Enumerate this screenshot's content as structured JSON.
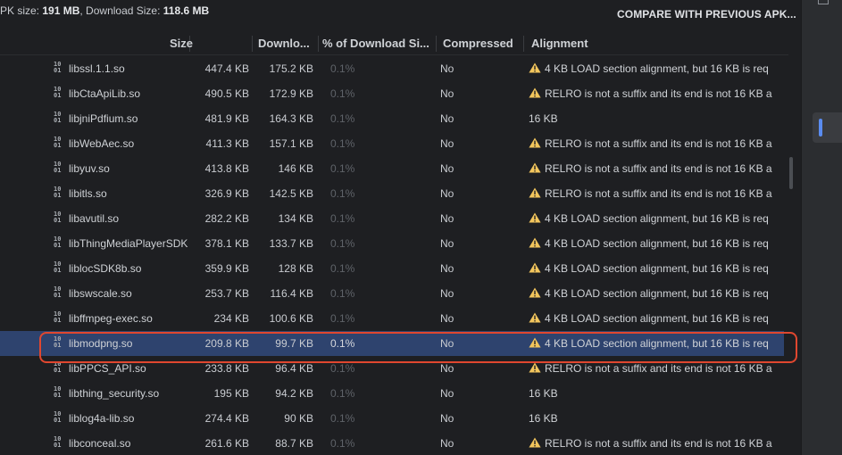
{
  "header": {
    "apk_size_label": "PK size: ",
    "apk_size_value": "191 MB",
    "download_size_label": ", Download Size: ",
    "download_size_value": "118.6 MB",
    "compare_button": "COMPARE WITH PREVIOUS APK..."
  },
  "columns": {
    "size": "Size",
    "download": "Downlo...",
    "percent": "% of Download Si...",
    "compressed": "Compressed",
    "alignment": "Alignment"
  },
  "rows": [
    {
      "name": "libssl.1.1.so",
      "size": "447.4 KB",
      "download": "175.2 KB",
      "percent": "0.1%",
      "compressed": "No",
      "alignment": "4 KB LOAD section alignment, but 16 KB is req",
      "warning": true
    },
    {
      "name": "libCtaApiLib.so",
      "size": "490.5 KB",
      "download": "172.9 KB",
      "percent": "0.1%",
      "compressed": "No",
      "alignment": "RELRO is not a suffix and its end is not 16 KB a",
      "warning": true
    },
    {
      "name": "libjniPdfium.so",
      "size": "481.9 KB",
      "download": "164.3 KB",
      "percent": "0.1%",
      "compressed": "No",
      "alignment": "16 KB",
      "warning": false
    },
    {
      "name": "libWebAec.so",
      "size": "411.3 KB",
      "download": "157.1 KB",
      "percent": "0.1%",
      "compressed": "No",
      "alignment": "RELRO is not a suffix and its end is not 16 KB a",
      "warning": true
    },
    {
      "name": "libyuv.so",
      "size": "413.8 KB",
      "download": "146 KB",
      "percent": "0.1%",
      "compressed": "No",
      "alignment": "RELRO is not a suffix and its end is not 16 KB a",
      "warning": true
    },
    {
      "name": "libitls.so",
      "size": "326.9 KB",
      "download": "142.5 KB",
      "percent": "0.1%",
      "compressed": "No",
      "alignment": "RELRO is not a suffix and its end is not 16 KB a",
      "warning": true
    },
    {
      "name": "libavutil.so",
      "size": "282.2 KB",
      "download": "134 KB",
      "percent": "0.1%",
      "compressed": "No",
      "alignment": "4 KB LOAD section alignment, but 16 KB is req",
      "warning": true
    },
    {
      "name": "libThingMediaPlayerSDK",
      "size": "378.1 KB",
      "download": "133.7 KB",
      "percent": "0.1%",
      "compressed": "No",
      "alignment": "4 KB LOAD section alignment, but 16 KB is req",
      "warning": true
    },
    {
      "name": "liblocSDK8b.so",
      "size": "359.9 KB",
      "download": "128 KB",
      "percent": "0.1%",
      "compressed": "No",
      "alignment": "4 KB LOAD section alignment, but 16 KB is req",
      "warning": true
    },
    {
      "name": "libswscale.so",
      "size": "253.7 KB",
      "download": "116.4 KB",
      "percent": "0.1%",
      "compressed": "No",
      "alignment": "4 KB LOAD section alignment, but 16 KB is req",
      "warning": true
    },
    {
      "name": "libffmpeg-exec.so",
      "size": "234 KB",
      "download": "100.6 KB",
      "percent": "0.1%",
      "compressed": "No",
      "alignment": "4 KB LOAD section alignment, but 16 KB is req",
      "warning": true
    },
    {
      "name": "libmodpng.so",
      "size": "209.8 KB",
      "download": "99.7 KB",
      "percent": "0.1%",
      "compressed": "No",
      "alignment": "4 KB LOAD section alignment, but 16 KB is req",
      "warning": true,
      "selected": true
    },
    {
      "name": "libPPCS_API.so",
      "size": "233.8 KB",
      "download": "96.4 KB",
      "percent": "0.1%",
      "compressed": "No",
      "alignment": "RELRO is not a suffix and its end is not 16 KB a",
      "warning": true
    },
    {
      "name": "libthing_security.so",
      "size": "195 KB",
      "download": "94.2 KB",
      "percent": "0.1%",
      "compressed": "No",
      "alignment": "16 KB",
      "warning": false
    },
    {
      "name": "liblog4a-lib.so",
      "size": "274.4 KB",
      "download": "90 KB",
      "percent": "0.1%",
      "compressed": "No",
      "alignment": "16 KB",
      "warning": false
    },
    {
      "name": "libconceal.so",
      "size": "261.6 KB",
      "download": "88.7 KB",
      "percent": "0.1%",
      "compressed": "No",
      "alignment": "RELRO is not a suffix and its end is not 16 KB a",
      "warning": true
    }
  ],
  "icons": {
    "file": "binary-file-icon",
    "warning": "warning-triangle-icon"
  },
  "colors": {
    "selected_row": "#2e436e",
    "highlight_ring": "#e0472f",
    "warning": "#f2c55c"
  }
}
